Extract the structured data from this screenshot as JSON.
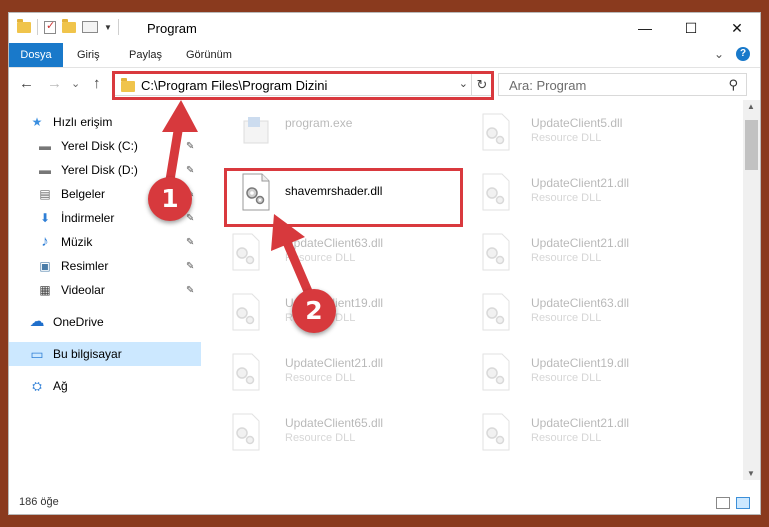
{
  "window": {
    "title": "Program",
    "controls": {
      "minimize": "—",
      "maximize": "☐",
      "close": "✕"
    }
  },
  "ribbon": {
    "tabs": [
      "Dosya",
      "Giriş",
      "Paylaş",
      "Görünüm"
    ],
    "expand_glyph": "⌄",
    "help_glyph": "?"
  },
  "nav": {
    "back": "←",
    "forward": "→",
    "recent": "⌄",
    "up": "↑",
    "address": "C:\\Program Files\\Program Dizini",
    "address_dropdown": "⌄",
    "refresh": "↻",
    "search_placeholder": "Ara: Program",
    "search_icon": "⚲"
  },
  "sidebar": {
    "items": [
      {
        "label": "Hızlı erişim",
        "icon": "star-icon",
        "glyph": "★",
        "color": "#3b8fe0",
        "pinned": false
      },
      {
        "label": "Yerel Disk (C:)",
        "icon": "drive-icon",
        "glyph": "▬",
        "color": "#777777",
        "pinned": true
      },
      {
        "label": "Yerel Disk (D:)",
        "icon": "drive-icon",
        "glyph": "▬",
        "color": "#777777",
        "pinned": true
      },
      {
        "label": "Belgeler",
        "icon": "document-icon",
        "glyph": "▤",
        "color": "#6a6a6a",
        "pinned": true
      },
      {
        "label": "İndirmeler",
        "icon": "download-icon",
        "glyph": "⬇",
        "color": "#2f7fd6",
        "pinned": true
      },
      {
        "label": "Müzik",
        "icon": "music-icon",
        "glyph": "♪",
        "color": "#2f7fd6",
        "pinned": true
      },
      {
        "label": "Resimler",
        "icon": "picture-icon",
        "glyph": "▣",
        "color": "#4a7ca8",
        "pinned": true
      },
      {
        "label": "Videolar",
        "icon": "video-icon",
        "glyph": "▦",
        "color": "#444444",
        "pinned": true
      },
      {
        "label": "OneDrive",
        "icon": "cloud-icon",
        "glyph": "☁",
        "color": "#1f6fcb",
        "pinned": false
      },
      {
        "label": "Bu bilgisayar",
        "icon": "computer-icon",
        "glyph": "▭",
        "color": "#2f7fd6",
        "pinned": false,
        "selected": true
      },
      {
        "label": "Ağ",
        "icon": "network-icon",
        "glyph": "⛭",
        "color": "#2f7fd6",
        "pinned": false
      }
    ],
    "pin_glyph": "✎"
  },
  "files": [
    {
      "name": "program.exe",
      "type": "",
      "faded": true,
      "icon": "exe-icon"
    },
    {
      "name": "shavemrshader.dll",
      "type": "",
      "faded": false,
      "icon": "dll-icon"
    },
    {
      "name": "UpdateClient63.dll",
      "type": "Resource DLL",
      "faded": true,
      "icon": "dll-icon"
    },
    {
      "name": "UpdateClient19.dll",
      "type": "Resource DLL",
      "faded": true,
      "icon": "dll-icon"
    },
    {
      "name": "UpdateClient21.dll",
      "type": "Resource DLL",
      "faded": true,
      "icon": "dll-icon"
    },
    {
      "name": "UpdateClient65.dll",
      "type": "Resource DLL",
      "faded": true,
      "icon": "dll-icon"
    },
    {
      "name": "UpdateClient5.dll",
      "type": "Resource DLL",
      "faded": true,
      "icon": "dll-icon"
    },
    {
      "name": "UpdateClient21.dll",
      "type": "Resource DLL",
      "faded": true,
      "icon": "dll-icon"
    },
    {
      "name": "UpdateClient21.dll",
      "type": "Resource DLL",
      "faded": true,
      "icon": "dll-icon"
    },
    {
      "name": "UpdateClient63.dll",
      "type": "Resource DLL",
      "faded": true,
      "icon": "dll-icon"
    },
    {
      "name": "UpdateClient19.dll",
      "type": "Resource DLL",
      "faded": true,
      "icon": "dll-icon"
    },
    {
      "name": "UpdateClient21.dll",
      "type": "Resource DLL",
      "faded": true,
      "icon": "dll-icon"
    }
  ],
  "status": {
    "item_count": "186 öğe"
  },
  "annotations": [
    {
      "number": "1",
      "color": "#d7393d"
    },
    {
      "number": "2",
      "color": "#d7393d"
    }
  ]
}
